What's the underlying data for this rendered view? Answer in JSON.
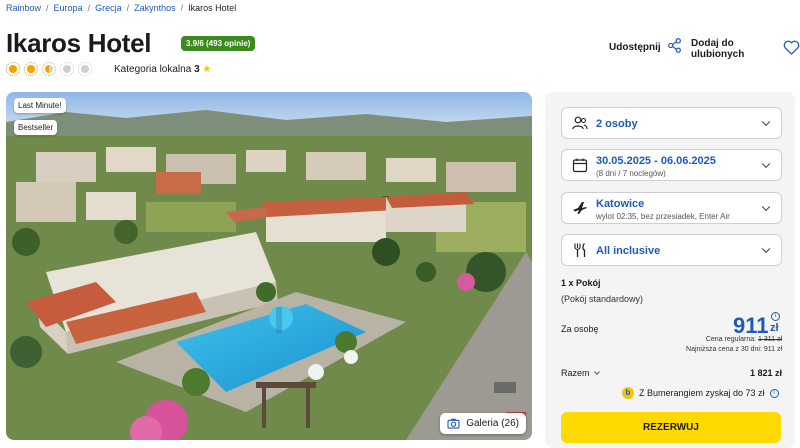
{
  "breadcrumb": [
    {
      "label": "Rainbow"
    },
    {
      "label": "Europa"
    },
    {
      "label": "Grecja"
    },
    {
      "label": "Zakynthos"
    },
    {
      "label": "Ikaros Hotel"
    }
  ],
  "hotel": {
    "name": "Ikaros Hotel",
    "rating_badge": "3.9/6 (493 opinie)",
    "sun_rating": 2.5,
    "sun_max": 5,
    "category_label": "Kategoria lokalna",
    "category_value": "3",
    "category_star": "★"
  },
  "actions": {
    "share_label": "Udostępnij",
    "favorite_label": "Dodaj do ulubionych"
  },
  "gallery": {
    "tags": [
      "Last Minute!",
      "Bestseller"
    ],
    "button_label": "Galeria (26)"
  },
  "booking": {
    "guests": "2 osoby",
    "dates": "30.05.2025 - 06.06.2025",
    "dates_sub": "(8 dni / 7 noclegów)",
    "departure": "Katowice",
    "departure_sub": "wylot 02:35, bez przesiadek, Enter Air",
    "board": "All inclusive",
    "room_count": "1 x Pokój",
    "room_type": "(Pokój standardowy)",
    "per_person_label": "Za osobę",
    "price": "911",
    "currency": "zł",
    "regular_label": "Cena regularna:",
    "regular_price": "1 311 zł",
    "lowest_label": "Najniższa cena z 30 dni: 911 zł",
    "total_label": "Razem",
    "total_value": "1 821 zł",
    "bumerang_text": "Z Bumerangiem zyskaj do 73 zł",
    "reserve_label": "REZERWUJ"
  },
  "colors": {
    "accent_blue": "#1e5bb8",
    "rating_green": "#3a8a1e",
    "reserve_yellow": "#ffd900",
    "sun_orange": "#f5a300"
  }
}
